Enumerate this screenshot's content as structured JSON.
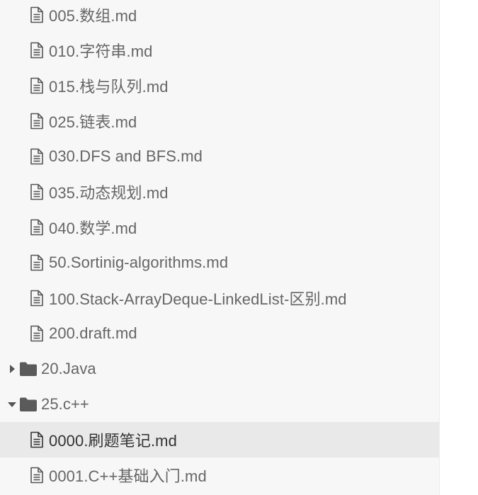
{
  "file_tree": {
    "items": [
      {
        "label": "005.数组.md"
      },
      {
        "label": "010.字符串.md"
      },
      {
        "label": "015.栈与队列.md"
      },
      {
        "label": "025.链表.md"
      },
      {
        "label": "030.DFS and BFS.md"
      },
      {
        "label": "035.动态规划.md"
      },
      {
        "label": "040.数学.md"
      },
      {
        "label": "50.Sortinig-algorithms.md"
      },
      {
        "label": "100.Stack-ArrayDeque-LinkedList-区别.md"
      },
      {
        "label": "200.draft.md"
      },
      {
        "label": "20.Java"
      },
      {
        "label": "25.c++"
      },
      {
        "label": "0000.刷题笔记.md"
      },
      {
        "label": "0001.C++基础入门.md"
      }
    ]
  }
}
